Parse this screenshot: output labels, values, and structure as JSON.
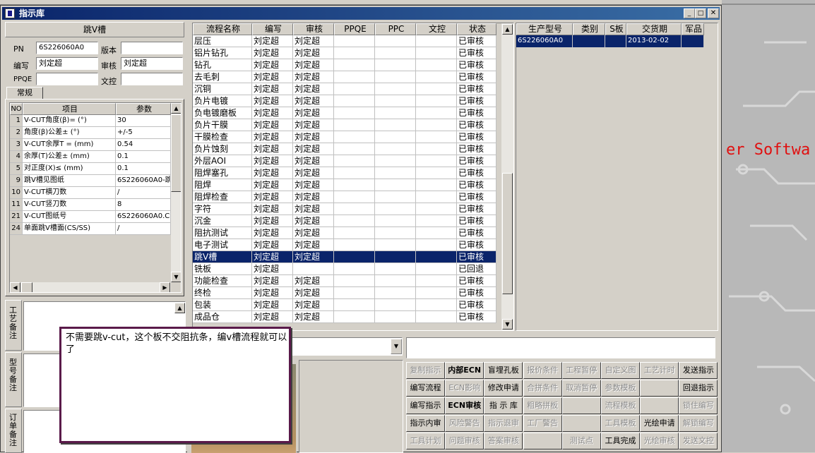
{
  "window": {
    "title": "指示库"
  },
  "left": {
    "title": "跳V槽",
    "fields": {
      "pn_label": "PN",
      "pn_value": "6S226060A0",
      "version_label": "版本",
      "version_value": "",
      "writer_label": "编写",
      "writer_value": "刘定超",
      "reviewer_label": "审核",
      "reviewer_value": "刘定超",
      "ppqe_label": "PPQE",
      "ppqe_value": "",
      "doc_label": "文控",
      "doc_value": ""
    },
    "tab": "常规",
    "param_headers": [
      "NO",
      "项目",
      "参数"
    ],
    "params": [
      {
        "no": "1",
        "item": "V-CUT角度(β)=  (°)",
        "value": "30"
      },
      {
        "no": "2",
        "item": "角度(β)公差±  (°)",
        "value": "+/-5"
      },
      {
        "no": "3",
        "item": "V-CUT余厚T =  (mm)",
        "value": "0.54"
      },
      {
        "no": "4",
        "item": "余厚(T)公差±   (mm)",
        "value": "0.1"
      },
      {
        "no": "5",
        "item": "对正度(X)≤ (mm)",
        "value": "0.1"
      },
      {
        "no": "9",
        "item": "跳V槽见图纸",
        "value": "6S226060A0-跳"
      },
      {
        "no": "10",
        "item": "V-CUT横刀数",
        "value": "/"
      },
      {
        "no": "11",
        "item": "V-CUT竖刀数",
        "value": "8"
      },
      {
        "no": "21",
        "item": "V-CUT图纸号",
        "value": "6S226060A0.CS"
      },
      {
        "no": "24",
        "item": "单面跳V槽面(CS/SS)",
        "value": "/"
      }
    ],
    "side_labels": [
      "工艺备注",
      "型号备注",
      "订单备注"
    ]
  },
  "process": {
    "headers": [
      "流程名称",
      "编写",
      "审核",
      "PPQE",
      "PPC",
      "文控",
      "状态"
    ],
    "rows": [
      {
        "name": "层压",
        "writer": "刘定超",
        "reviewer": "刘定超",
        "status": "已审核"
      },
      {
        "name": "铝片钻孔",
        "writer": "刘定超",
        "reviewer": "刘定超",
        "status": "已审核"
      },
      {
        "name": "钻孔",
        "writer": "刘定超",
        "reviewer": "刘定超",
        "status": "已审核"
      },
      {
        "name": "去毛刺",
        "writer": "刘定超",
        "reviewer": "刘定超",
        "status": "已审核"
      },
      {
        "name": "沉铜",
        "writer": "刘定超",
        "reviewer": "刘定超",
        "status": "已审核"
      },
      {
        "name": "负片电镀",
        "writer": "刘定超",
        "reviewer": "刘定超",
        "status": "已审核"
      },
      {
        "name": "负电镀磨板",
        "writer": "刘定超",
        "reviewer": "刘定超",
        "status": "已审核"
      },
      {
        "name": "负片干膜",
        "writer": "刘定超",
        "reviewer": "刘定超",
        "status": "已审核"
      },
      {
        "name": "干膜检查",
        "writer": "刘定超",
        "reviewer": "刘定超",
        "status": "已审核"
      },
      {
        "name": "负片蚀刻",
        "writer": "刘定超",
        "reviewer": "刘定超",
        "status": "已审核"
      },
      {
        "name": "外层AOI",
        "writer": "刘定超",
        "reviewer": "刘定超",
        "status": "已审核"
      },
      {
        "name": "阻焊塞孔",
        "writer": "刘定超",
        "reviewer": "刘定超",
        "status": "已审核"
      },
      {
        "name": "阻焊",
        "writer": "刘定超",
        "reviewer": "刘定超",
        "status": "已审核"
      },
      {
        "name": "阻焊检查",
        "writer": "刘定超",
        "reviewer": "刘定超",
        "status": "已审核"
      },
      {
        "name": "字符",
        "writer": "刘定超",
        "reviewer": "刘定超",
        "status": "已审核"
      },
      {
        "name": "沉金",
        "writer": "刘定超",
        "reviewer": "刘定超",
        "status": "已审核"
      },
      {
        "name": "阻抗测试",
        "writer": "刘定超",
        "reviewer": "刘定超",
        "status": "已审核"
      },
      {
        "name": "电子测试",
        "writer": "刘定超",
        "reviewer": "刘定超",
        "status": "已审核"
      },
      {
        "name": "跳V槽",
        "writer": "刘定超",
        "reviewer": "刘定超",
        "status": "已审核",
        "selected": true
      },
      {
        "name": "铣板",
        "writer": "刘定超",
        "reviewer": "",
        "status": "已回退"
      },
      {
        "name": "功能检查",
        "writer": "刘定超",
        "reviewer": "刘定超",
        "status": "已审核"
      },
      {
        "name": "终检",
        "writer": "刘定超",
        "reviewer": "刘定超",
        "status": "已审核"
      },
      {
        "name": "包装",
        "writer": "刘定超",
        "reviewer": "刘定超",
        "status": "已审核"
      },
      {
        "name": "成品仓",
        "writer": "刘定超",
        "reviewer": "刘定超",
        "status": "已审核"
      }
    ]
  },
  "products": {
    "headers": [
      "生产型号",
      "类别",
      "S板",
      "交货期",
      "军品"
    ],
    "rows": [
      {
        "model": "6S226060A0",
        "category": "",
        "s_board": "",
        "delivery": "2013-02-02",
        "military": ""
      }
    ]
  },
  "tooltip": {
    "text": "不需要跳v-cut，这个板不交阻抗条，编v槽流程就可以了"
  },
  "background_text": "er Softwa",
  "buttons": [
    [
      {
        "label": "复制指示",
        "enabled": false
      },
      {
        "label": "内部ECN",
        "enabled": true,
        "bold": true
      },
      {
        "label": "盲埋孔板",
        "enabled": true
      },
      {
        "label": "报价条件",
        "enabled": false
      },
      {
        "label": "工程暂停",
        "enabled": false
      },
      {
        "label": "自定义图",
        "enabled": false
      },
      {
        "label": "工艺计时",
        "enabled": false
      },
      {
        "label": "发送指示",
        "enabled": true
      }
    ],
    [
      {
        "label": "编写流程",
        "enabled": true
      },
      {
        "label": "ECN影响",
        "enabled": false
      },
      {
        "label": "修改申请",
        "enabled": true
      },
      {
        "label": "合拼条件",
        "enabled": false
      },
      {
        "label": "取消暂停",
        "enabled": false
      },
      {
        "label": "参数模板",
        "enabled": false
      },
      {
        "label": "",
        "enabled": false
      },
      {
        "label": "回退指示",
        "enabled": true
      }
    ],
    [
      {
        "label": "编写指示",
        "enabled": true
      },
      {
        "label": "ECN审核",
        "enabled": true,
        "bold": true
      },
      {
        "label": "指 示 库",
        "enabled": true
      },
      {
        "label": "粗略拼板",
        "enabled": false
      },
      {
        "label": "",
        "enabled": false
      },
      {
        "label": "流程模板",
        "enabled": false
      },
      {
        "label": "",
        "enabled": false
      },
      {
        "label": "锁住编写",
        "enabled": false
      }
    ],
    [
      {
        "label": "指示内审",
        "enabled": true
      },
      {
        "label": "风险警告",
        "enabled": false
      },
      {
        "label": "指示退审",
        "enabled": false
      },
      {
        "label": "工厂警告",
        "enabled": false
      },
      {
        "label": "",
        "enabled": false
      },
      {
        "label": "工具模板",
        "enabled": false
      },
      {
        "label": "光绘申请",
        "enabled": true
      },
      {
        "label": "解锁编写",
        "enabled": false
      }
    ],
    [
      {
        "label": "工具计划",
        "enabled": false
      },
      {
        "label": "问题审核",
        "enabled": false
      },
      {
        "label": "答案审核",
        "enabled": false
      },
      {
        "label": "",
        "enabled": false
      },
      {
        "label": "测试点",
        "enabled": false
      },
      {
        "label": "工具完成",
        "enabled": true
      },
      {
        "label": "光绘审核",
        "enabled": false
      },
      {
        "label": "发送文控",
        "enabled": false
      }
    ]
  ],
  "colors": {
    "titlebar": "#0a246a",
    "selection": "#0a246a",
    "tooltip_border": "#5a1a4a",
    "bg_red": "#e01010"
  }
}
